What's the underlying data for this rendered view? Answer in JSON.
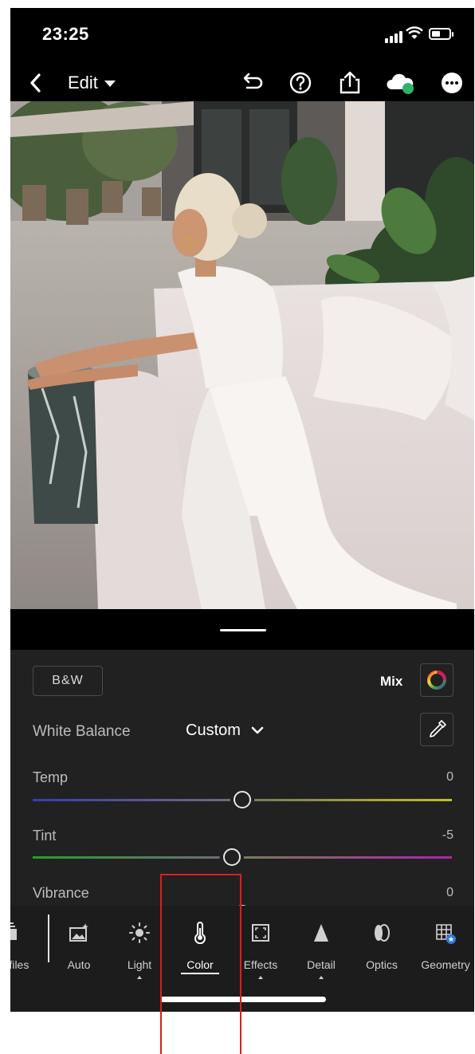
{
  "status": {
    "time": "23:25"
  },
  "nav": {
    "back_icon": "chevron-left-icon",
    "title": "Edit",
    "icons": [
      "undo-icon",
      "help-icon",
      "share-icon",
      "cloud-sync-icon",
      "more-icon"
    ]
  },
  "panel": {
    "bw_label": "B&W",
    "mix_label": "Mix",
    "white_balance_label": "White Balance",
    "white_balance_value": "Custom",
    "sliders": [
      {
        "label": "Temp",
        "value": "0",
        "position": 0.5,
        "colors": [
          "#3b3bb0",
          "#bfbf2a"
        ]
      },
      {
        "label": "Tint",
        "value": "-5",
        "position": 0.475,
        "colors": [
          "#2f9a2f",
          "#a52aa5"
        ]
      },
      {
        "label": "Vibrance",
        "value": "0",
        "position": 0.5
      }
    ]
  },
  "toolbar": {
    "items": [
      {
        "label": "Profiles",
        "icon": "profiles-icon"
      },
      {
        "label": "Auto",
        "icon": "auto-icon"
      },
      {
        "label": "Light",
        "icon": "sun-icon"
      },
      {
        "label": "Color",
        "icon": "thermometer-icon",
        "active": true
      },
      {
        "label": "Effects",
        "icon": "effects-icon"
      },
      {
        "label": "Detail",
        "icon": "detail-icon"
      },
      {
        "label": "Optics",
        "icon": "optics-icon"
      },
      {
        "label": "Geometry",
        "icon": "geometry-icon"
      }
    ]
  },
  "colors": {
    "accent": "#ffffff",
    "panel_bg": "#212121",
    "annotation": "#d61f1f"
  }
}
